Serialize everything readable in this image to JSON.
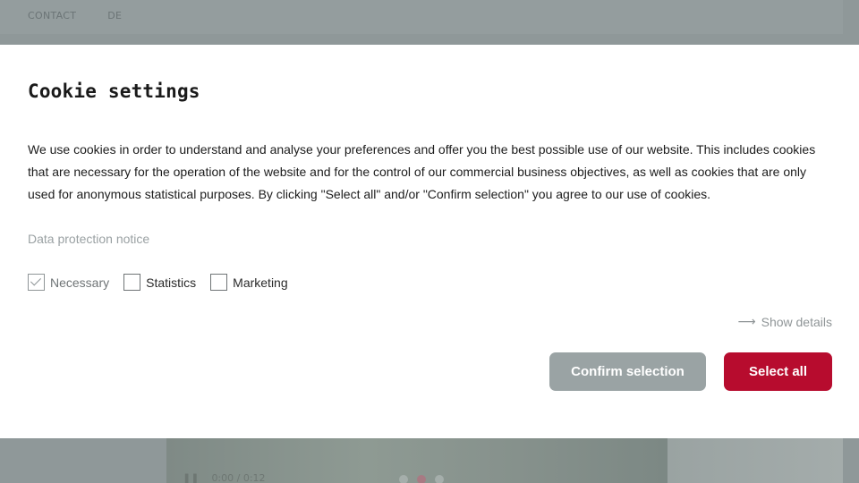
{
  "background": {
    "nav": [
      "CONTACT",
      "DE"
    ],
    "video": {
      "time": "0:00 / 0:12"
    }
  },
  "modal": {
    "title": "Cookie settings",
    "text": "We use cookies in order to understand and analyse your preferences and offer you the best possible use of our website. This includes cookies that are necessary for the operation of the website and for the control of our commercial business objectives, as well as cookies that are only used for anonymous statistical purposes. By clicking \"Select all\" and/or \"Confirm selection\" you agree to our use of cookies.",
    "privacy_link": "Data protection notice",
    "checkboxes": [
      {
        "label": "Necessary",
        "checked": true,
        "disabled": true
      },
      {
        "label": "Statistics",
        "checked": false,
        "disabled": false
      },
      {
        "label": "Marketing",
        "checked": false,
        "disabled": false
      }
    ],
    "show_details": "Show details",
    "confirm_label": "Confirm selection",
    "select_all_label": "Select all"
  },
  "colors": {
    "accent": "#b70c2e",
    "secondary_button": "#9aa3a4",
    "overlay": "#8e9799"
  }
}
